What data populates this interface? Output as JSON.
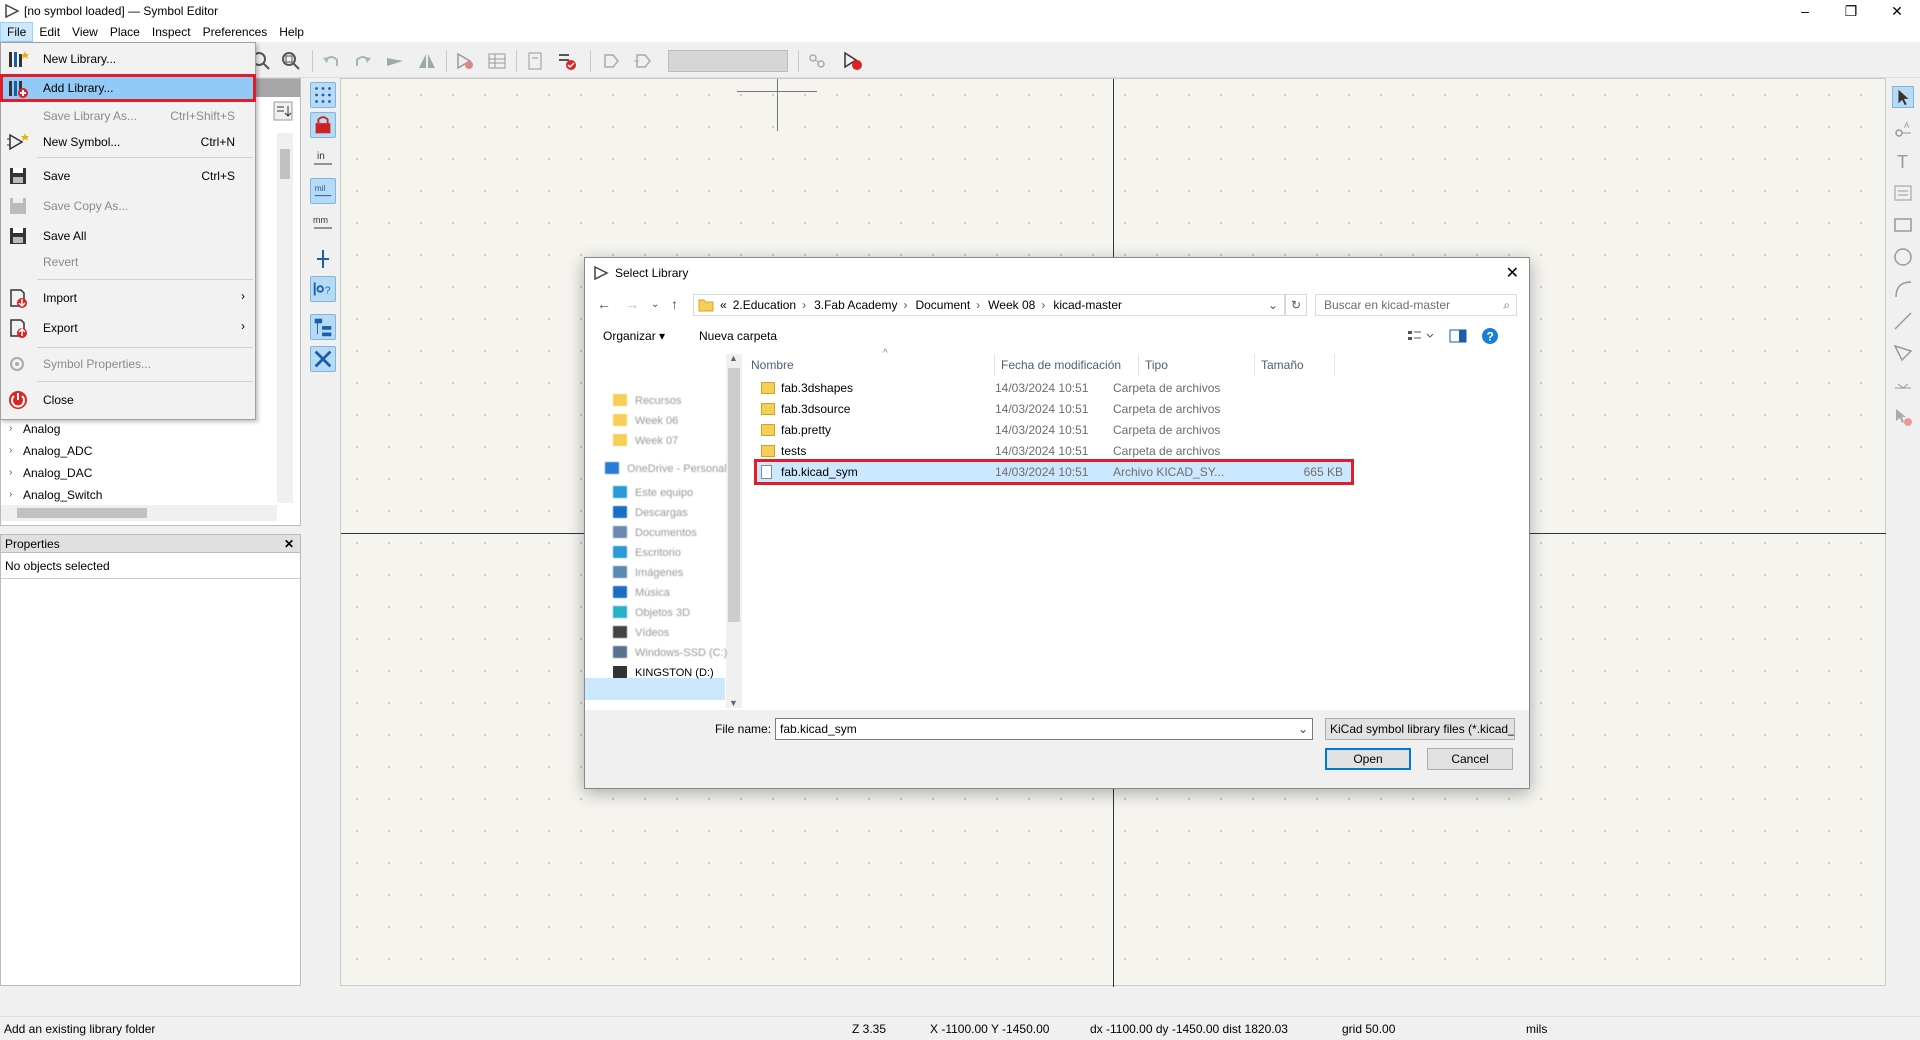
{
  "window": {
    "title": "[no symbol loaded] — Symbol Editor",
    "controls": [
      "–",
      "❐",
      "✕"
    ]
  },
  "menubar": [
    "File",
    "Edit",
    "View",
    "Place",
    "Inspect",
    "Preferences",
    "Help"
  ],
  "file_menu": {
    "items": [
      {
        "label": "New Library...",
        "shortcut": "",
        "icon": "new-library-icon"
      },
      {
        "label": "Add Library...",
        "shortcut": "",
        "icon": "add-library-icon"
      },
      {
        "label": "Save Library As...",
        "shortcut": "Ctrl+Shift+S",
        "icon": ""
      },
      {
        "label": "New Symbol...",
        "shortcut": "Ctrl+N",
        "icon": "new-symbol-icon"
      },
      {
        "label": "Save",
        "shortcut": "Ctrl+S",
        "icon": "save-icon"
      },
      {
        "label": "Save Copy As...",
        "shortcut": "",
        "icon": "save-copy-icon"
      },
      {
        "label": "Save All",
        "shortcut": "",
        "icon": "save-all-icon"
      },
      {
        "label": "Revert",
        "shortcut": "",
        "icon": ""
      },
      {
        "label": "Import",
        "shortcut": "",
        "icon": "import-icon"
      },
      {
        "label": "Export",
        "shortcut": "",
        "icon": "export-icon"
      },
      {
        "label": "Symbol Properties...",
        "shortcut": "",
        "icon": "symbol-properties-icon"
      },
      {
        "label": "Close",
        "shortcut": "",
        "icon": "power-icon"
      }
    ],
    "submenu_arrow": "›"
  },
  "library_tree": {
    "items": [
      "Analog",
      "Analog_ADC",
      "Analog_DAC",
      "Analog_Switch"
    ]
  },
  "properties": {
    "title": "Properties",
    "close": "✕",
    "status": "No objects selected"
  },
  "dialog": {
    "title": "Select Library",
    "close": "✕",
    "breadcrumb": [
      "«",
      "2.Education",
      "3.Fab Academy",
      "Document",
      "Week 08",
      "kicad-master"
    ],
    "search_placeholder": "Buscar en kicad-master",
    "organize": "Organizar ▾",
    "new_folder": "Nueva carpeta",
    "help": "?",
    "tree_items": [
      {
        "label": "Recursos",
        "clear": false
      },
      {
        "label": "Week 06",
        "clear": false
      },
      {
        "label": "Week 07",
        "clear": false
      },
      {
        "label": "OneDrive - Personal",
        "clear": false
      },
      {
        "label": "Este equipo",
        "clear": false
      },
      {
        "label": "Descargas",
        "clear": false
      },
      {
        "label": "Documentos",
        "clear": false
      },
      {
        "label": "Escritorio",
        "clear": false
      },
      {
        "label": "Imágenes",
        "clear": false
      },
      {
        "label": "Música",
        "clear": false
      },
      {
        "label": "Objetos 3D",
        "clear": false
      },
      {
        "label": "Vídeos",
        "clear": false
      },
      {
        "label": "Windows-SSD (C:)",
        "clear": false
      },
      {
        "label": "KINGSTON (D:)",
        "clear": true
      }
    ],
    "columns": [
      "Nombre",
      "Fecha de modificación",
      "Tipo",
      "Tamaño"
    ],
    "files": [
      {
        "name": "fab.3dshapes",
        "date": "14/03/2024 10:51",
        "type": "Carpeta de archivos",
        "size": "",
        "kind": "folder"
      },
      {
        "name": "fab.3dsource",
        "date": "14/03/2024 10:51",
        "type": "Carpeta de archivos",
        "size": "",
        "kind": "folder"
      },
      {
        "name": "fab.pretty",
        "date": "14/03/2024 10:51",
        "type": "Carpeta de archivos",
        "size": "",
        "kind": "folder"
      },
      {
        "name": "tests",
        "date": "14/03/2024 10:51",
        "type": "Carpeta de archivos",
        "size": "",
        "kind": "folder"
      },
      {
        "name": "fab.kicad_sym",
        "date": "14/03/2024 10:51",
        "type": "Archivo KICAD_SY...",
        "size": "665 KB",
        "kind": "file"
      }
    ],
    "file_name_label": "File name:",
    "file_name_value": "fab.kicad_sym",
    "file_type": "KiCad symbol library files (*.kicad_sym)",
    "open_label": "Open",
    "cancel_label": "Cancel"
  },
  "statusbar": {
    "message": "Add an existing library folder",
    "zoom": "Z 3.35",
    "xy": "X -1100.00  Y -1450.00",
    "delta": "dx -1100.00  dy -1450.00  dist 1820.03",
    "grid": "grid 50.00",
    "units": "mils"
  },
  "colors": {
    "highlight_red": "#e11d2a",
    "menu_selected": "#91c9f7",
    "canvas_bg": "#f5f4ef",
    "axis": "#333344"
  }
}
